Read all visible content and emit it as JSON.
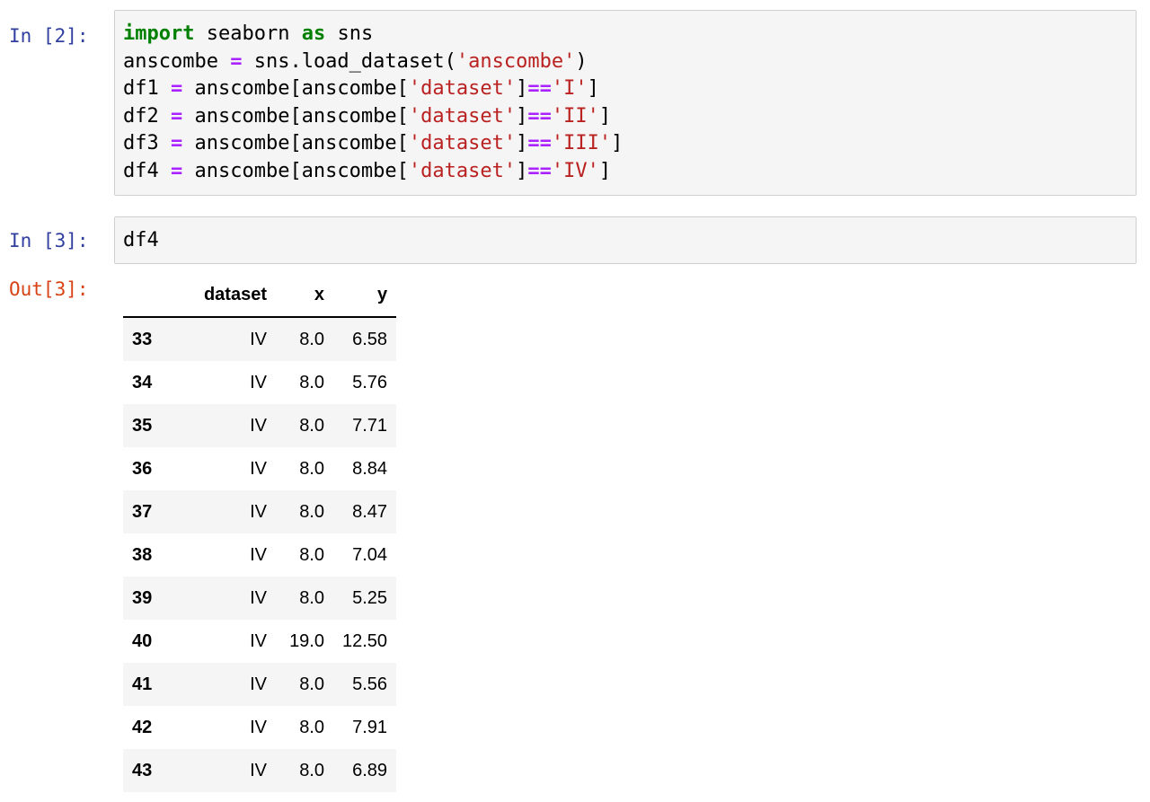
{
  "cells": [
    {
      "prompt": "In [2]:",
      "code_lines": [
        [
          {
            "t": "kw",
            "v": "import"
          },
          {
            "t": "n",
            "v": " seaborn "
          },
          {
            "t": "kw",
            "v": "as"
          },
          {
            "t": "n",
            "v": " sns"
          }
        ],
        [
          {
            "t": "n",
            "v": "anscombe "
          },
          {
            "t": "op",
            "v": "="
          },
          {
            "t": "n",
            "v": " sns.load_dataset("
          },
          {
            "t": "str",
            "v": "'anscombe'"
          },
          {
            "t": "n",
            "v": ")"
          }
        ],
        [
          {
            "t": "n",
            "v": "df1 "
          },
          {
            "t": "op",
            "v": "="
          },
          {
            "t": "n",
            "v": " anscombe[anscombe["
          },
          {
            "t": "str",
            "v": "'dataset'"
          },
          {
            "t": "n",
            "v": "]"
          },
          {
            "t": "op",
            "v": "=="
          },
          {
            "t": "str",
            "v": "'I'"
          },
          {
            "t": "n",
            "v": "]"
          }
        ],
        [
          {
            "t": "n",
            "v": "df2 "
          },
          {
            "t": "op",
            "v": "="
          },
          {
            "t": "n",
            "v": " anscombe[anscombe["
          },
          {
            "t": "str",
            "v": "'dataset'"
          },
          {
            "t": "n",
            "v": "]"
          },
          {
            "t": "op",
            "v": "=="
          },
          {
            "t": "str",
            "v": "'II'"
          },
          {
            "t": "n",
            "v": "]"
          }
        ],
        [
          {
            "t": "n",
            "v": "df3 "
          },
          {
            "t": "op",
            "v": "="
          },
          {
            "t": "n",
            "v": " anscombe[anscombe["
          },
          {
            "t": "str",
            "v": "'dataset'"
          },
          {
            "t": "n",
            "v": "]"
          },
          {
            "t": "op",
            "v": "=="
          },
          {
            "t": "str",
            "v": "'III'"
          },
          {
            "t": "n",
            "v": "]"
          }
        ],
        [
          {
            "t": "n",
            "v": "df4 "
          },
          {
            "t": "op",
            "v": "="
          },
          {
            "t": "n",
            "v": " anscombe[anscombe["
          },
          {
            "t": "str",
            "v": "'dataset'"
          },
          {
            "t": "n",
            "v": "]"
          },
          {
            "t": "op",
            "v": "=="
          },
          {
            "t": "str",
            "v": "'IV'"
          },
          {
            "t": "n",
            "v": "]"
          }
        ]
      ]
    },
    {
      "prompt": "In [3]:",
      "code_lines": [
        [
          {
            "t": "n",
            "v": "df4"
          }
        ]
      ]
    }
  ],
  "output": {
    "prompt": "Out[3]:",
    "table": {
      "columns": [
        "",
        "dataset",
        "x",
        "y"
      ],
      "rows": [
        [
          "33",
          "IV",
          "8.0",
          "6.58"
        ],
        [
          "34",
          "IV",
          "8.0",
          "5.76"
        ],
        [
          "35",
          "IV",
          "8.0",
          "7.71"
        ],
        [
          "36",
          "IV",
          "8.0",
          "8.84"
        ],
        [
          "37",
          "IV",
          "8.0",
          "8.47"
        ],
        [
          "38",
          "IV",
          "8.0",
          "7.04"
        ],
        [
          "39",
          "IV",
          "8.0",
          "5.25"
        ],
        [
          "40",
          "IV",
          "19.0",
          "12.50"
        ],
        [
          "41",
          "IV",
          "8.0",
          "5.56"
        ],
        [
          "42",
          "IV",
          "8.0",
          "7.91"
        ],
        [
          "43",
          "IV",
          "8.0",
          "6.89"
        ]
      ]
    }
  },
  "colors": {
    "in_prompt": "#303f9f",
    "out_prompt": "#d84315",
    "keyword": "#008000",
    "operator": "#aa22ff",
    "string": "#ba2121",
    "cell_bg": "#f5f5f5",
    "cell_border": "#cfcfcf"
  }
}
